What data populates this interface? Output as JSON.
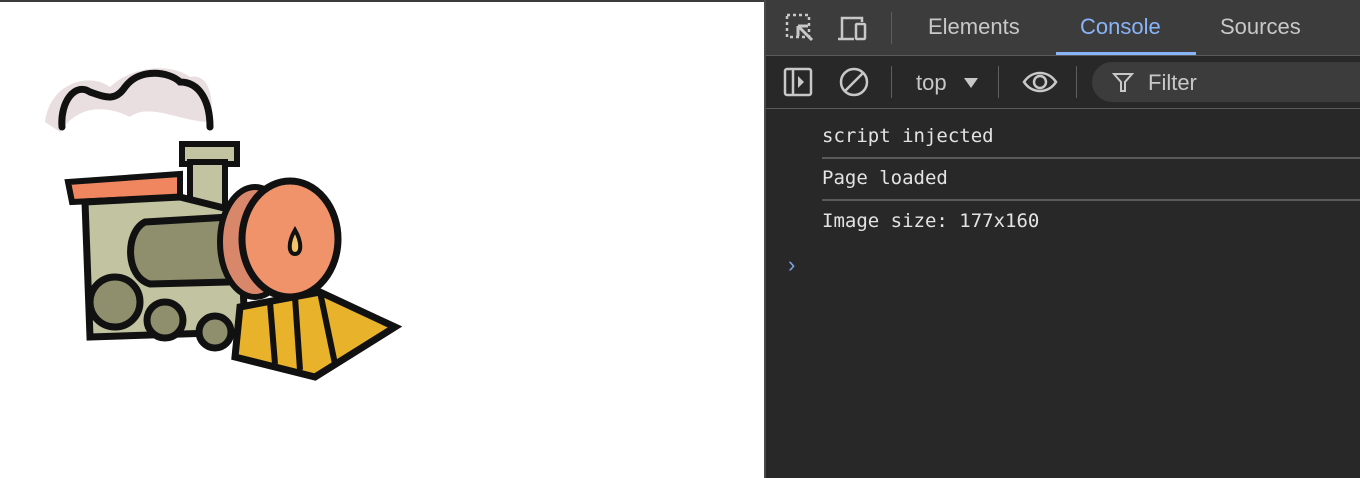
{
  "page": {
    "image_alt": "train"
  },
  "devtools": {
    "tabs": [
      {
        "label": "Elements",
        "active": false
      },
      {
        "label": "Console",
        "active": true
      },
      {
        "label": "Sources",
        "active": false
      }
    ],
    "toolbar": {
      "context": "top",
      "filter_placeholder": "Filter"
    },
    "console": {
      "messages": [
        "script injected",
        "Page loaded",
        "Image size: 177x160"
      ],
      "prompt": "›"
    },
    "colors": {
      "accent": "#8ab4f8",
      "background": "#282828",
      "tabbar": "#3c3c3c"
    }
  }
}
